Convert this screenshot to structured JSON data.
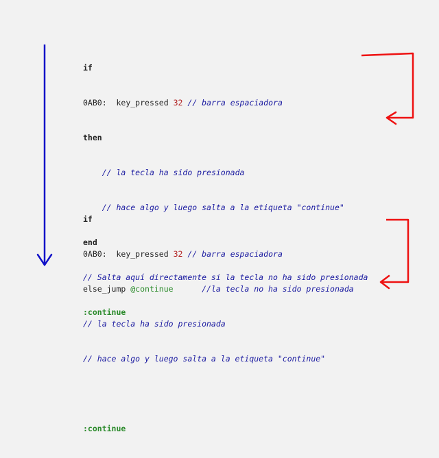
{
  "colors": {
    "background": "#f2f2f2",
    "blue_arrow": "#1010c8",
    "red_arrow": "#ee1111",
    "keyword": "#222222",
    "number": "#b22222",
    "label": "#2a8a2a",
    "comment": "#1a1aa0"
  },
  "block1": {
    "if": "if",
    "opcode": "0AB0:",
    "command": "key_pressed",
    "number": "32",
    "comment_space": "// barra espaciadora",
    "then": "then",
    "comment_pressed": "// la tecla ha sido presionada",
    "comment_does": "// hace algo y luego salta a la etiqueta \"continue\"",
    "end": "end",
    "comment_jump": "// Salta aquí directamente si la tecla no ha sido presionada",
    "label": ":continue"
  },
  "block2": {
    "if": "if",
    "opcode": "0AB0:",
    "command": "key_pressed",
    "number": "32",
    "comment_space": "// barra espaciadora",
    "else_jump": "else_jump",
    "target": "@continue",
    "comment_not_pressed": "//la tecla no ha sido presionada",
    "comment_pressed": "// la tecla ha sido presionada",
    "comment_does": "// hace algo y luego salta a la etiqueta \"continue\"",
    "label": ":continue"
  },
  "icons": [
    "flow-down-arrow-icon",
    "jump-arrow-icon"
  ]
}
